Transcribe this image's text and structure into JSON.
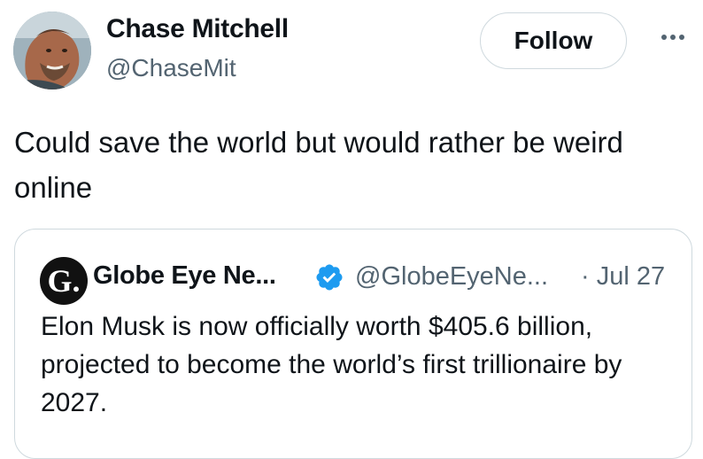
{
  "author": {
    "display_name": "Chase Mitchell",
    "handle": "@ChaseMit",
    "avatar_icon": "profile-photo"
  },
  "actions": {
    "follow_label": "Follow",
    "more_icon": "more-horizontal-icon"
  },
  "tweet": {
    "text": "Could save the world but would rather be weird online"
  },
  "quoted_tweet": {
    "logo_letter": "G.",
    "display_name": "Globe Eye Ne...",
    "verified": true,
    "verified_icon": "verified-badge-icon",
    "handle": "@GlobeEyeNe...",
    "date": "· Jul 27",
    "text": "Elon Musk is now officially worth $405.6 billion, projected to become the world’s first trillionaire by 2027."
  },
  "colors": {
    "text_primary": "#0f1419",
    "text_secondary": "#536471",
    "border": "#cfd9de",
    "verified_blue": "#1d9bf0"
  }
}
